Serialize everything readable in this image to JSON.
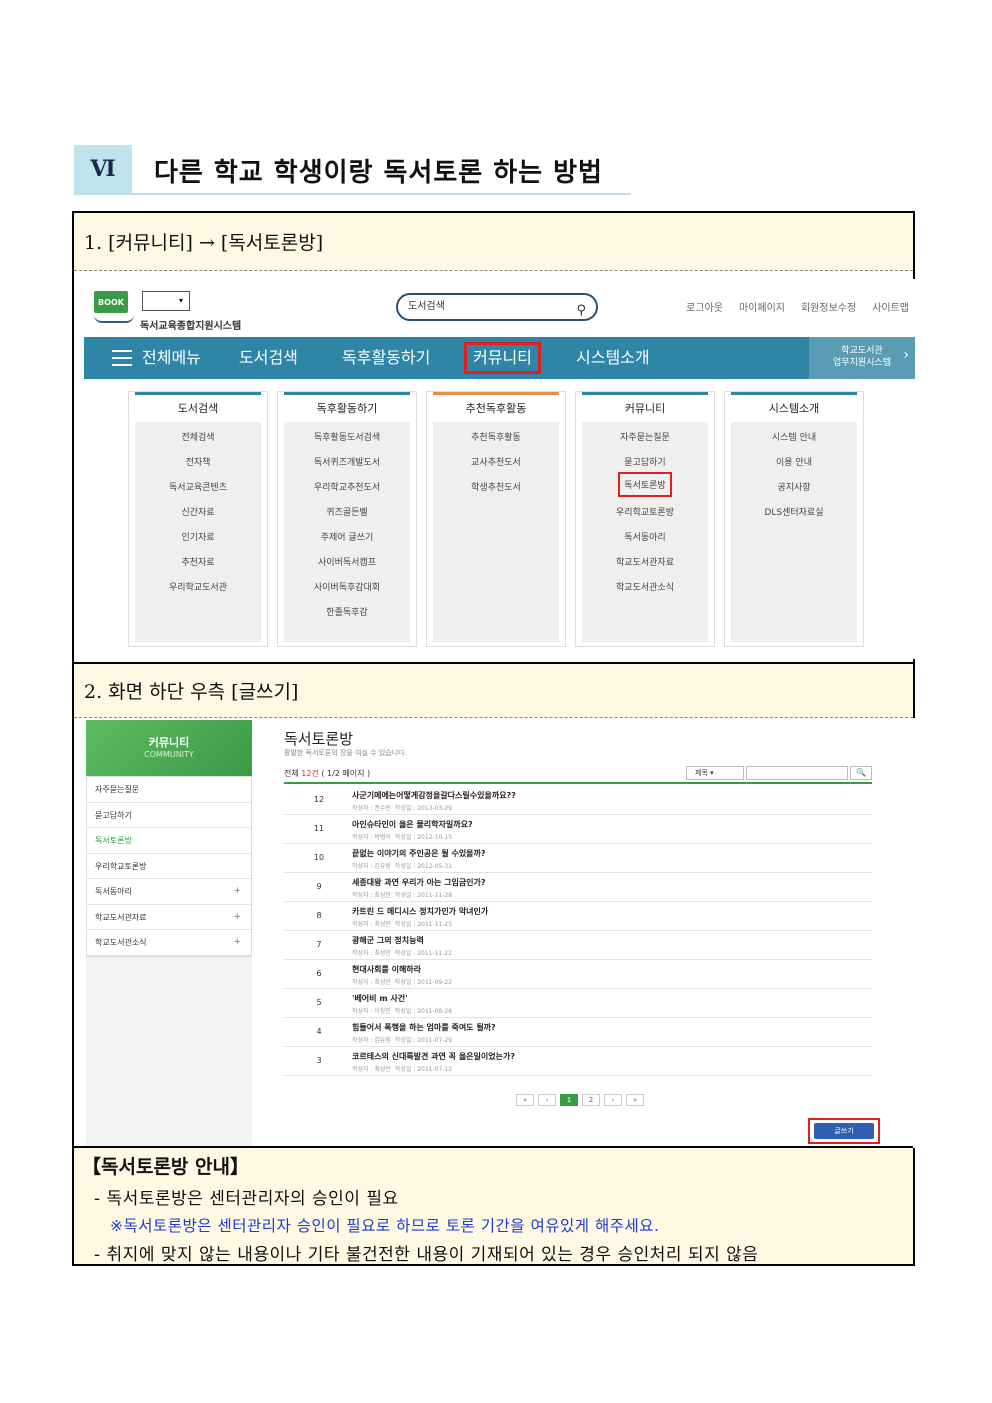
{
  "section": {
    "number": "Ⅵ",
    "title": "다른 학교 학생이랑 독서토론 하는 방법"
  },
  "step1": {
    "label": "1. [커뮤니티] → [독서토론방]"
  },
  "step2": {
    "label": "2. 화면 하단 우측 [글쓰기]"
  },
  "site": {
    "logo_badge": "BOOK",
    "logo_text": "독서교육종합지원시스템",
    "search_placeholder": "도서검색",
    "top_links": [
      "로그아웃",
      "마이페이지",
      "회원정보수정",
      "사이트맵"
    ],
    "nav": {
      "all_menu": "전체메뉴",
      "items": [
        "도서검색",
        "독후활동하기",
        "커뮤니티",
        "시스템소개"
      ],
      "right_line1": "학교도서관",
      "right_line2": "업무지원시스템"
    },
    "menu_columns": [
      {
        "head": "도서검색",
        "items": [
          "전체검색",
          "전자책",
          "독서교육콘텐츠",
          "신간자료",
          "인기자료",
          "추천자료",
          "우리학교도서관"
        ]
      },
      {
        "head": "독후활동하기",
        "items": [
          "독후활동도서검색",
          "독서퀴즈개발도서",
          "우리학교추천도서",
          "퀴즈골든벨",
          "주제어 글쓰기",
          "사이버독서캠프",
          "사이버독후감대회",
          "한줄독후감"
        ]
      },
      {
        "head": "추천독후활동",
        "items": [
          "추천독후활동",
          "교사추천도서",
          "학생추천도서"
        ]
      },
      {
        "head": "커뮤니티",
        "items": [
          "자주묻는질문",
          "묻고답하기",
          "독서토론방",
          "우리학교토론방",
          "독서동아리",
          "학교도서관자료",
          "학교도서관소식"
        ]
      },
      {
        "head": "시스템소개",
        "items": [
          "시스템 안내",
          "이용 안내",
          "공지사항",
          "DLS센터자료실"
        ]
      }
    ]
  },
  "board": {
    "side_title": "커뮤니티",
    "side_sub": "COMMUNITY",
    "side_items": [
      {
        "label": "자주묻는질문",
        "plus": ""
      },
      {
        "label": "묻고답하기",
        "plus": ""
      },
      {
        "label": "독서토론방",
        "plus": ""
      },
      {
        "label": "우리학교토론방",
        "plus": ""
      },
      {
        "label": "독서동아리",
        "plus": "+"
      },
      {
        "label": "학교도서관자료",
        "plus": "+"
      },
      {
        "label": "학교도서관소식",
        "plus": "+"
      }
    ],
    "title": "독서토론방",
    "subtitle": "활발한 독서토론의 장을 여실 수 있습니다.",
    "count_prefix": "전체 ",
    "count_value": "12건",
    "count_suffix": " ( 1/2 페이지 )",
    "search_select": "제목",
    "search_button": "🔍",
    "rows": [
      {
        "num": "12",
        "title": "사군기메에는어떻게감정을갈다스릴수있을까요??",
        "author": "작성자 : 권수빈",
        "date": "작성일 : 2013-03-29"
      },
      {
        "num": "11",
        "title": "아인슈타인이 옳은 물리학자일까요?",
        "author": "작성자 : 박병식",
        "date": "작성일 : 2012-10-15"
      },
      {
        "num": "10",
        "title": "끝없는 이야기의 주인공은 될 수있을까?",
        "author": "작성자 : 김유림",
        "date": "작성일 : 2012-05-31"
      },
      {
        "num": "9",
        "title": "세종대왕 과연 우리가 아는 그임금인가?",
        "author": "작성자 : 최성민",
        "date": "작성일 : 2011-11-28"
      },
      {
        "num": "8",
        "title": "카트린 드 메디시스 정치가인가 악녀인가",
        "author": "작성자 : 최성민",
        "date": "작성일 : 2011-11-25"
      },
      {
        "num": "7",
        "title": "광해군 그의 정치능력",
        "author": "작성자 : 최성민",
        "date": "작성일 : 2011-11-22"
      },
      {
        "num": "6",
        "title": "현대사회를 이해하라",
        "author": "작성자 : 최성민",
        "date": "작성일 : 2011-09-22"
      },
      {
        "num": "5",
        "title": "'베어비 m 사건'",
        "author": "작성자 : 이창민",
        "date": "작성일 : 2011-08-28"
      },
      {
        "num": "4",
        "title": "힘들어서 폭행을 하는 엄마를 죽여도 될까?",
        "author": "작성자 : 김유림",
        "date": "작성일 : 2011-07-29"
      },
      {
        "num": "3",
        "title": "코르테스의 신대륙발견 과연 꼭 옳은일이었는가?",
        "author": "작성자 : 최성민",
        "date": "작성일 : 2011-07-12"
      }
    ],
    "pager": [
      "«",
      "‹",
      "1",
      "2",
      "›",
      "»"
    ],
    "write_button": "글쓰기"
  },
  "info": {
    "title": "【독서토론방 안내】",
    "line1": "- 독서토론방은 센터관리자의 승인이 필요",
    "note": "※독서토론방은 센터관리자 승인이 필요로 하므로 토론 기간을 여유있게 해주세요.",
    "line2": "- 취지에 맞지 않는 내용이나 기타 불건전한 내용이 기재되어 있는 경우 승인처리 되지 않음"
  }
}
